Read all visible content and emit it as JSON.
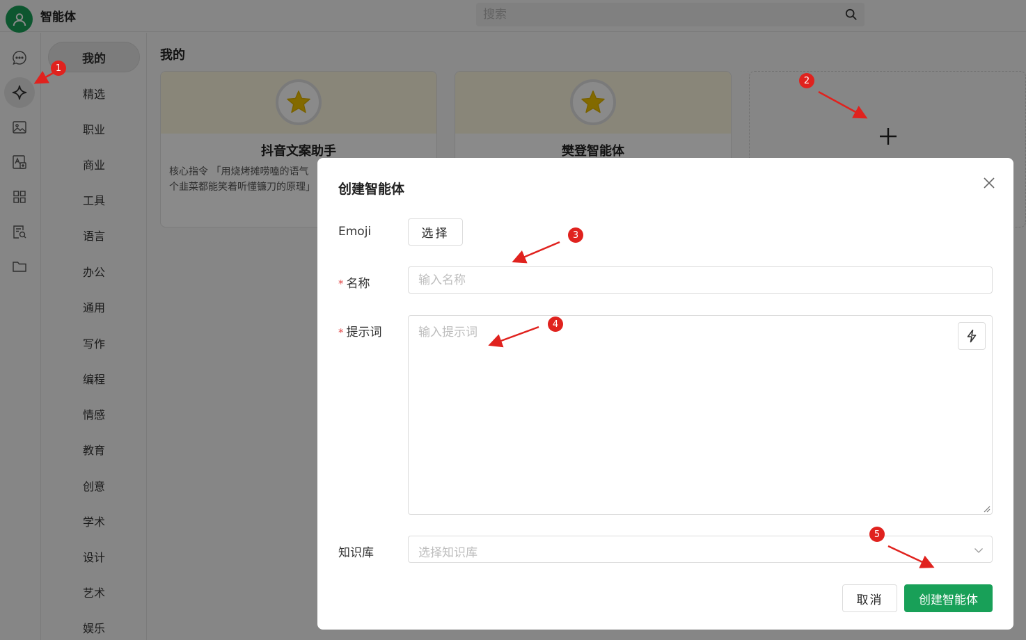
{
  "header": {
    "app_title": "智能体",
    "search_placeholder": "搜索"
  },
  "rail": {
    "icons": [
      "chat-icon",
      "sparkle-icon",
      "image-icon",
      "translate-icon",
      "apps-grid-icon",
      "doc-search-icon",
      "folder-icon"
    ],
    "active_index": 1
  },
  "categories": {
    "active": "我的",
    "items": [
      "我的",
      "精选",
      "职业",
      "商业",
      "工具",
      "语言",
      "办公",
      "通用",
      "写作",
      "编程",
      "情感",
      "教育",
      "创意",
      "学术",
      "设计",
      "艺术",
      "娱乐"
    ]
  },
  "main": {
    "section_title": "我的",
    "cards": [
      {
        "name": "抖音文案助手",
        "desc_line1": "核心指令 「用烧烤摊唠嗑的语气",
        "desc_line2": "个韭菜都能笑着听懂镰刀的原理」",
        "icon": "star-icon"
      },
      {
        "name": "樊登智能体",
        "desc_line1": "",
        "desc_line2": "",
        "icon": "star-icon"
      }
    ]
  },
  "modal": {
    "title": "创建智能体",
    "emoji_label": "Emoji",
    "emoji_button": "选择",
    "name_label": "名称",
    "name_placeholder": "输入名称",
    "prompt_label": "提示词",
    "prompt_placeholder": "输入提示词",
    "kb_label": "知识库",
    "kb_placeholder": "选择知识库",
    "required_mark": "*",
    "cancel_button": "取消",
    "create_button": "创建智能体"
  },
  "annotations": [
    "1",
    "2",
    "3",
    "4",
    "5"
  ],
  "colors": {
    "accent": "#18a058",
    "annotation": "#e0221e",
    "required": "#e24c4c"
  }
}
